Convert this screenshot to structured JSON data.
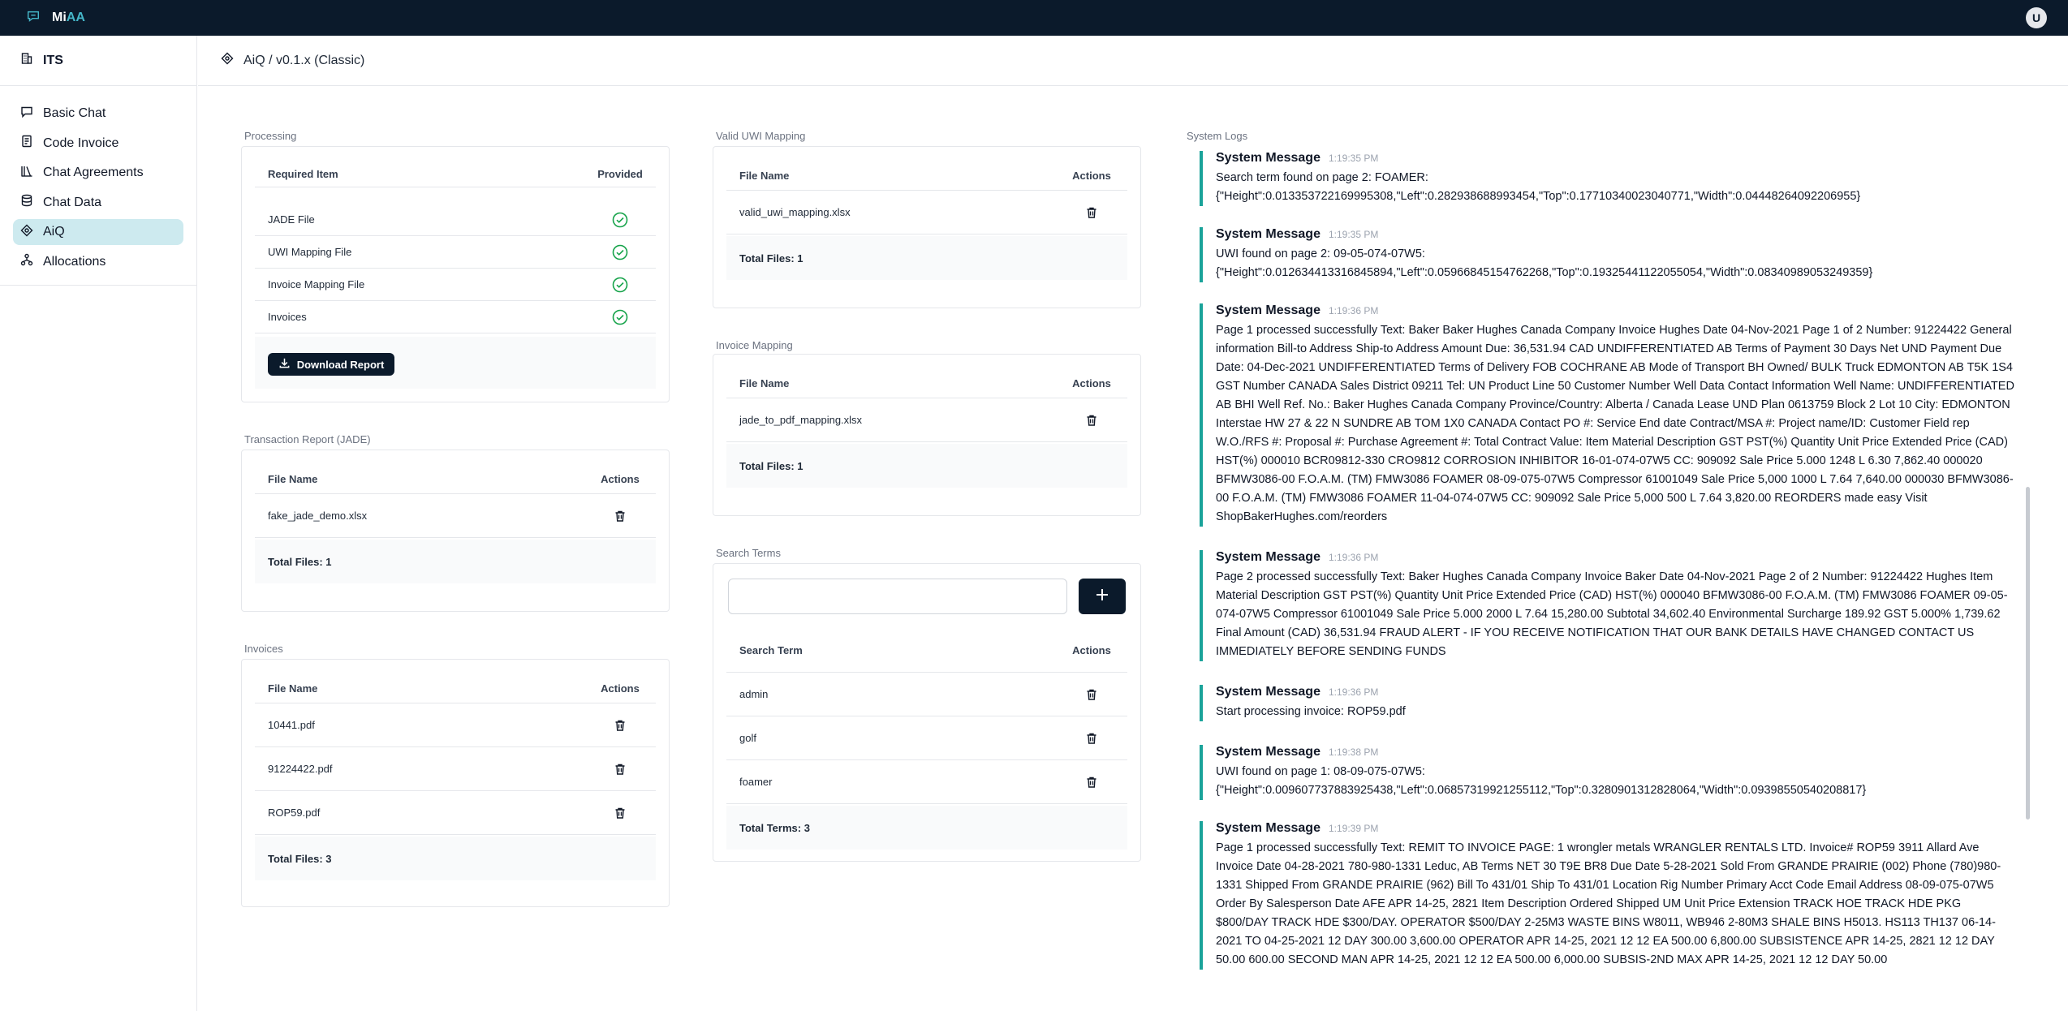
{
  "app": {
    "brand_prefix": "Mi",
    "brand_suffix": "AA",
    "user_initial": "U"
  },
  "sidebar": {
    "title": "ITS",
    "items": [
      {
        "label": "Basic Chat",
        "icon": "chat-bubble-icon"
      },
      {
        "label": "Code Invoice",
        "icon": "document-icon"
      },
      {
        "label": "Chat Agreements",
        "icon": "books-icon"
      },
      {
        "label": "Chat Data",
        "icon": "database-icon"
      },
      {
        "label": "AiQ",
        "icon": "aiq-icon",
        "active": true
      },
      {
        "label": "Allocations",
        "icon": "network-icon"
      }
    ]
  },
  "header": {
    "breadcrumb": "AiQ / v0.1.x (Classic)"
  },
  "processing": {
    "label": "Processing",
    "col_item": "Required Item",
    "col_provided": "Provided",
    "rows": [
      {
        "item": "JADE File"
      },
      {
        "item": "UWI Mapping File"
      },
      {
        "item": "Invoice Mapping File"
      },
      {
        "item": "Invoices"
      }
    ],
    "download_label": "Download Report"
  },
  "transaction": {
    "label": "Transaction Report (JADE)",
    "col_name": "File Name",
    "col_actions": "Actions",
    "files": [
      "fake_jade_demo.xlsx"
    ],
    "total": "Total Files: 1"
  },
  "invoices": {
    "label": "Invoices",
    "col_name": "File Name",
    "col_actions": "Actions",
    "files": [
      "10441.pdf",
      "91224422.pdf",
      "ROP59.pdf"
    ],
    "total": "Total Files: 3"
  },
  "uwi": {
    "label": "Valid UWI Mapping",
    "col_name": "File Name",
    "col_actions": "Actions",
    "files": [
      "valid_uwi_mapping.xlsx"
    ],
    "total": "Total Files: 1"
  },
  "invoice_mapping": {
    "label": "Invoice Mapping",
    "col_name": "File Name",
    "col_actions": "Actions",
    "files": [
      "jade_to_pdf_mapping.xlsx"
    ],
    "total": "Total Files: 1"
  },
  "search": {
    "label": "Search Terms",
    "input_value": "",
    "col_term": "Search Term",
    "col_actions": "Actions",
    "terms": [
      "admin",
      "golf",
      "foamer"
    ],
    "total": "Total Terms: 3"
  },
  "logs": {
    "label": "System Logs",
    "entries": [
      {
        "type": "System Message",
        "time": "1:19:35 PM",
        "text": "Search term found on page 2: FOAMER:\n{\"Height\":0.013353722169995308,\"Left\":0.282938688993454,\"Top\":0.17710340023040771,\"Width\":0.04448264092206955}"
      },
      {
        "type": "System Message",
        "time": "1:19:35 PM",
        "text": "UWI found on page 2: 09-05-074-07W5:\n{\"Height\":0.012634413316845894,\"Left\":0.05966845154762268,\"Top\":0.19325441122055054,\"Width\":0.08340989053249359}"
      },
      {
        "type": "System Message",
        "time": "1:19:36 PM",
        "text": "Page 1 processed successfully Text: Baker Baker Hughes Canada Company Invoice Hughes Date 04-Nov-2021 Page 1 of 2 Number: 91224422 General information Bill-to Address Ship-to Address Amount Due: 36,531.94 CAD UNDIFFERENTIATED AB Terms of Payment 30 Days Net UND Payment Due Date: 04-Dec-2021 UNDIFFERENTIATED Terms of Delivery FOB COCHRANE AB Mode of Transport BH Owned/ BULK Truck EDMONTON AB T5K 1S4 GST Number CANADA Sales District 09211 Tel: UN Product Line 50 Customer Number Well Data Contact Information Well Name: UNDIFFERENTIATED AB BHI Well Ref. No.: Baker Hughes Canada Company Province/Country: Alberta / Canada Lease UND Plan 0613759 Block 2 Lot 10 City: EDMONTON Interstae HW 27 & 22 N SUNDRE AB TOM 1X0 CANADA Contact PO #: Service End date Contract/MSA #: Project name/ID: Customer Field rep W.O./RFS #: Proposal #: Purchase Agreement #: Total Contract Value: Item Material Description GST PST(%) Quantity Unit Price Extended Price (CAD) HST(%) 000010 BCR09812-330 CRO9812 CORROSION INHIBITOR 16-01-074-07W5 CC: 909092 Sale Price 5.000 1248 L 6.30 7,862.40 000020 BFMW3086-00 F.O.A.M. (TM) FMW3086 FOAMER 08-09-075-07W5 Compressor 61001049 Sale Price 5,000 1000 L 7.64 7,640.00 000030 BFMW3086-00 F.O.A.M. (TM) FMW3086 FOAMER 11-04-074-07W5 CC: 909092 Sale Price 5,000 500 L 7.64 3,820.00 REORDERS made easy Visit ShopBakerHughes.com/reorders"
      },
      {
        "type": "System Message",
        "time": "1:19:36 PM",
        "text": "Page 2 processed successfully Text: Baker Hughes Canada Company Invoice Baker Date 04-Nov-2021 Page 2 of 2 Number: 91224422 Hughes Item Material Description GST PST(%) Quantity Unit Price Extended Price (CAD) HST(%) 000040 BFMW3086-00 F.O.A.M. (TM) FMW3086 FOAMER 09-05-074-07W5 Compressor 61001049 Sale Price 5.000 2000 L 7.64 15,280.00 Subtotal 34,602.40 Environmental Surcharge 189.92 GST 5.000% 1,739.62 Final Amount (CAD) 36,531.94 FRAUD ALERT - IF YOU RECEIVE NOTIFICATION THAT OUR BANK DETAILS HAVE CHANGED CONTACT US IMMEDIATELY BEFORE SENDING FUNDS"
      },
      {
        "type": "System Message",
        "time": "1:19:36 PM",
        "text": "Start processing invoice: ROP59.pdf"
      },
      {
        "type": "System Message",
        "time": "1:19:38 PM",
        "text": "UWI found on page 1: 08-09-075-07W5:\n{\"Height\":0.009607737883925438,\"Left\":0.06857319921255112,\"Top\":0.3280901312828064,\"Width\":0.09398550540208817}"
      },
      {
        "type": "System Message",
        "time": "1:19:39 PM",
        "text": "Page 1 processed successfully Text: REMIT TO INVOICE PAGE: 1 wrongler metals WRANGLER RENTALS LTD. Invoice# ROP59 3911 Allard Ave Invoice Date 04-28-2021 780-980-1331 Leduc, AB Terms NET 30 T9E BR8 Due Date 5-28-2021 Sold From GRANDE PRAIRIE (002) Phone (780)980-1331 Shipped From GRANDE PRAIRIE (962) Bill To 431/01 Ship To 431/01 Location Rig Number Primary Acct Code Email Address 08-09-075-07W5 Order By Salesperson Date AFE APR 14-25, 2821 Item Description Ordered Shipped UM Unit Price Extension TRACK HOE TRACK HDE PKG $800/DAY TRACK HDE $300/DAY. OPERATOR $500/DAY 2-25M3 WASTE BINS W8011, WB946 2-80M3 SHALE BINS H5013. HS113 TH137 06-14-2021 TO 04-25-2021 12 DAY 300.00 3,600.00 OPERATOR APR 14-25, 2021 12 12 EA 500.00 6,800.00 SUBSISTENCE APR 14-25, 2821 12 12 DAY 50.00 600.00 SECOND MAN APR 14-25, 2021 12 12 EA 500.00 6,000.00 SUBSIS-2ND MAX APR 14-25, 2021 12 12 DAY 50.00"
      }
    ]
  }
}
